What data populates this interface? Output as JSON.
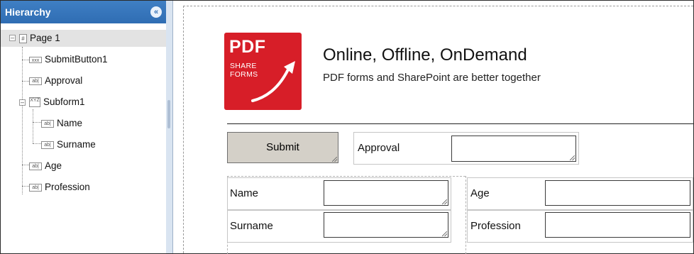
{
  "hierarchy": {
    "title": "Hierarchy",
    "collapse_symbol": "«",
    "items": [
      {
        "label": "Page 1",
        "icon": "page-icon",
        "icon_text": "#"
      },
      {
        "label": "SubmitButton1",
        "icon": "button-icon",
        "icon_text": "xxx"
      },
      {
        "label": "Approval",
        "icon": "textfield-icon",
        "icon_text": "ab|"
      },
      {
        "label": "Subform1",
        "icon": "subform-icon",
        "icon_text": "XYZ"
      },
      {
        "label": "Name",
        "icon": "textfield-icon",
        "icon_text": "ab|"
      },
      {
        "label": "Surname",
        "icon": "textfield-icon",
        "icon_text": "ab|"
      },
      {
        "label": "Age",
        "icon": "textfield-icon",
        "icon_text": "ab|"
      },
      {
        "label": "Profession",
        "icon": "textfield-icon",
        "icon_text": "ab|"
      }
    ]
  },
  "form": {
    "logo": {
      "line1": "PDF",
      "line2": "SHARE",
      "line3": "FORMS",
      "color": "#d71e28"
    },
    "headline": "Online, Offline, OnDemand",
    "subheadline": "PDF forms and SharePoint are better together",
    "submit_label": "Submit",
    "fields": {
      "approval": "Approval",
      "name": "Name",
      "surname": "Surname",
      "age": "Age",
      "profession": "Profession"
    }
  }
}
